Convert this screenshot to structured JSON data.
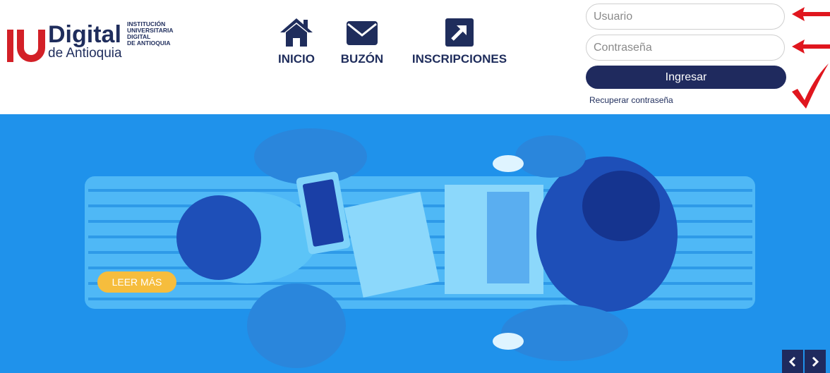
{
  "logo": {
    "brand_main": "Digital",
    "brand_sub": "de Antioquia",
    "institution_lines": [
      "INSTITUCIÓN",
      "UNIVERSITARIA",
      "DIGITAL",
      "DE ANTIOQUIA"
    ],
    "colors": {
      "red": "#d32027",
      "navy": "#1f2d5c"
    }
  },
  "nav": {
    "items": [
      {
        "label": "INICIO",
        "icon": "home-icon"
      },
      {
        "label": "BUZÓN",
        "icon": "envelope-icon"
      },
      {
        "label": "INSCRIPCIONES",
        "icon": "external-arrow-icon"
      }
    ]
  },
  "login": {
    "username_placeholder": "Usuario",
    "password_placeholder": "Contraseña",
    "submit_label": "Ingresar",
    "recover_link": "Recuperar contraseña",
    "annotations": [
      "red-arrow-icon",
      "red-arrow-icon",
      "red-checkmark-icon"
    ]
  },
  "hero": {
    "cta_label": "LEER MÁS",
    "prev_icon": "chevron-left-icon",
    "next_icon": "chevron-right-icon",
    "colors": {
      "tint": "#1f8fe9",
      "cta": "#f6bd3d",
      "nav": "#1f2a5e"
    }
  }
}
